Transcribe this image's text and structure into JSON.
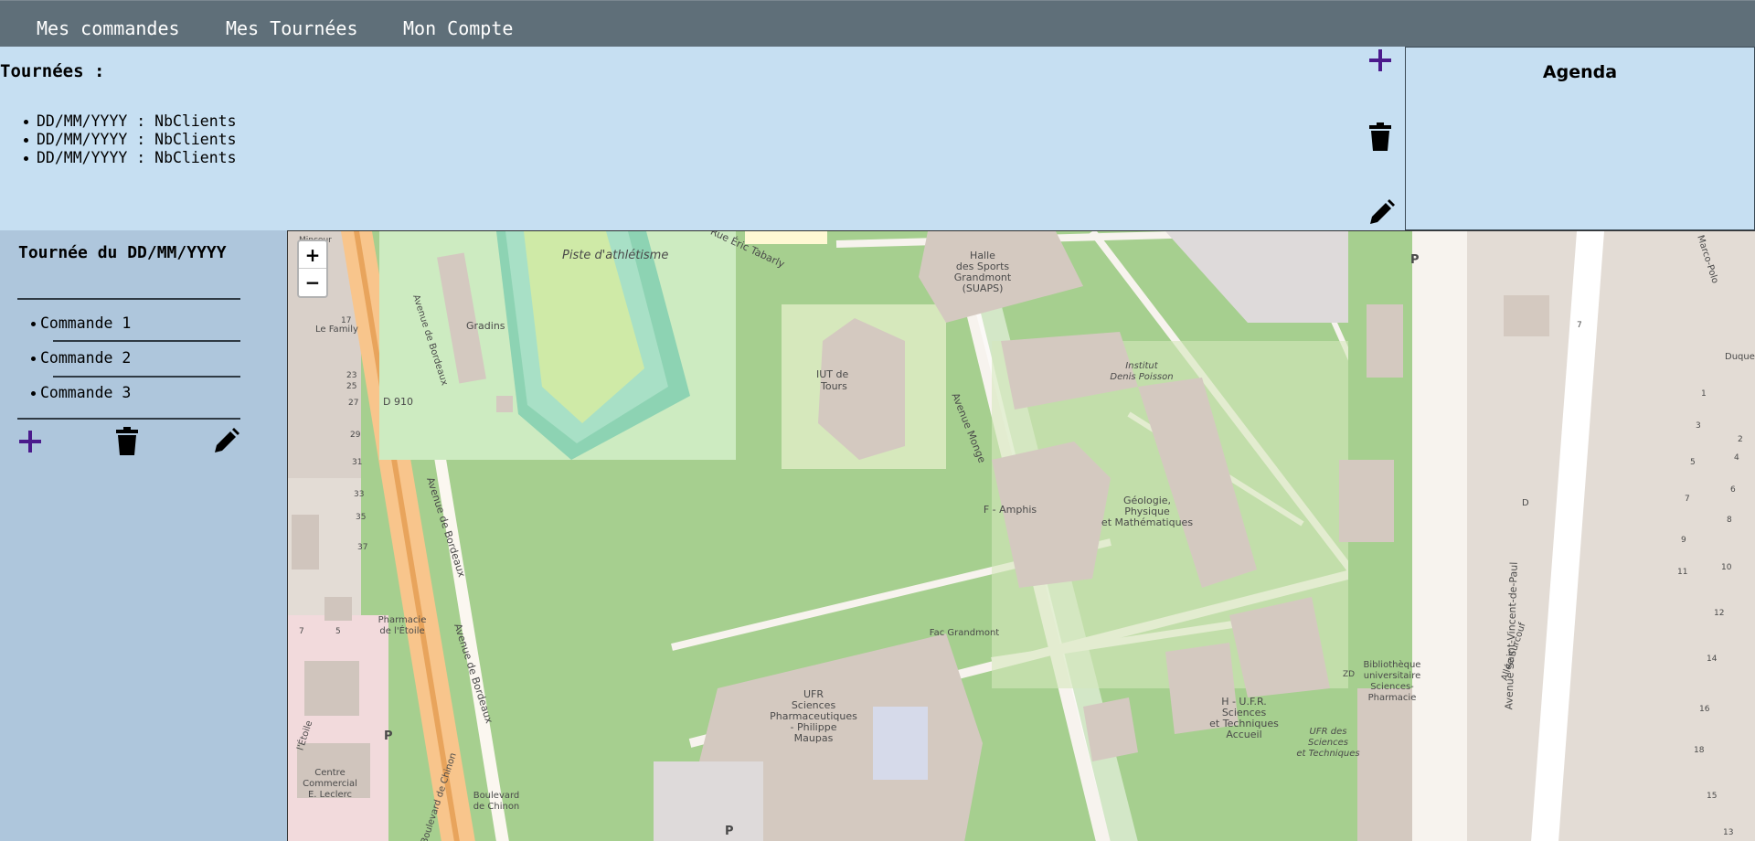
{
  "nav": {
    "items": [
      "Mes commandes",
      "Mes Tournées",
      "Mon Compte"
    ]
  },
  "tournees": {
    "title": "Tournées :",
    "items": [
      "DD/MM/YYYY : NbClients",
      "DD/MM/YYYY : NbClients",
      "DD/MM/YYYY : NbClients"
    ],
    "icons": {
      "add": "plus-icon",
      "delete": "trash-icon",
      "edit": "pencil-icon"
    }
  },
  "agenda": {
    "title": "Agenda"
  },
  "tournee_detail": {
    "title": "Tournée du DD/MM/YYYY",
    "commandes": [
      "Commande 1",
      "Commande 2",
      "Commande 3"
    ],
    "icons": {
      "add": "plus-icon",
      "delete": "trash-icon",
      "edit": "pencil-icon"
    }
  },
  "map": {
    "zoom_in": "+",
    "zoom_out": "−",
    "labels": {
      "piste": "Piste d'athlétisme",
      "eric_tabarly": "Rue Éric Tabarly",
      "gradins": "Gradins",
      "le_family": "Le Family",
      "d910": "D 910",
      "av_bordeaux_1": "Avenue de Bordeaux",
      "av_bordeaux_2": "Avenue de Bordeaux",
      "av_bordeaux_3": "Avenue de Bordeaux",
      "iut_1": "IUT de",
      "iut_2": "Tours",
      "halle_1": "Halle",
      "halle_2": "des Sports",
      "halle_3": "Grandmont",
      "halle_4": "(SUAPS)",
      "institut_1": "Institut",
      "institut_2": "Denis Poisson",
      "f_amphis": "F - Amphis",
      "avenue_monge": "Avenue Monge",
      "geologie_1": "Géologie,",
      "geologie_2": "Physique",
      "geologie_3": "et Mathématiques",
      "fac_grandmont": "Fac Grandmont",
      "pharmacie_1": "Pharmacie",
      "pharmacie_2": "de l'Étoile",
      "ufr_sc_1": "UFR",
      "ufr_sc_2": "Sciences",
      "ufr_sc_3": "Pharmaceutiques",
      "ufr_sc_4": "- Philippe",
      "ufr_sc_5": "Maupas",
      "h_ufr_1": "H - U.F.R.",
      "h_ufr_2": "Sciences",
      "h_ufr_3": "et Techniques",
      "h_ufr_4": "Accueil",
      "ufr_st_1": "UFR des",
      "ufr_st_2": "Sciences",
      "ufr_st_3": "et Techniques",
      "biblio_1": "Bibliothèque",
      "biblio_2": "universitaire",
      "biblio_3": "Sciences-",
      "biblio_4": "Pharmacie",
      "centre_1": "Centre",
      "centre_2": "Commercial",
      "centre_3": "E. Leclerc",
      "boulevard_1": "Boulevard",
      "boulevard_2": "de Chinon",
      "bd_chinon": "Boulevard de Chinon",
      "etoile": "l'Étoile",
      "minceur": "Minceur",
      "saint_vincent": "Avenue Saint-Vincent-de-Paul",
      "allee_surcouf": "Allée Surcouf",
      "marco_polo": "Marco-Polo",
      "duque": "Duque",
      "d_building": "D",
      "zd": "ZD",
      "n17": "17",
      "n23": "23",
      "n25": "25",
      "n27": "27",
      "n29": "29",
      "n31": "31",
      "n33": "33",
      "n35": "35",
      "n37": "37",
      "n7a": "7",
      "n5a": "5",
      "n1": "1",
      "n3": "3",
      "n5": "5",
      "n7": "7",
      "n9": "9",
      "n11": "11",
      "n2": "2",
      "n4": "4",
      "n6": "6",
      "n8": "8",
      "n10": "10",
      "n12": "12",
      "n14": "14",
      "n16": "16",
      "n18": "18",
      "n15": "15",
      "n13": "13",
      "n7b": "7",
      "parking": "P"
    }
  },
  "colors": {
    "nav_bg": "#5f6f79",
    "panel_bg": "#c6dff2",
    "sidebar_bg": "#aec6dc",
    "accent_purple": "#4b1a8c",
    "icon_black": "#000000"
  }
}
